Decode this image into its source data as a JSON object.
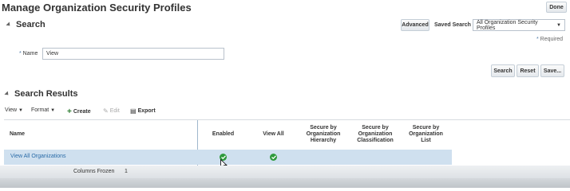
{
  "page": {
    "title": "Manage Organization Security Profiles"
  },
  "header": {
    "done_label": "Done"
  },
  "search": {
    "heading": "Search",
    "advanced_label": "Advanced",
    "saved_search_label": "Saved Search",
    "saved_search_value": "All Organization Security Profiles",
    "required_note": "Required",
    "name_label": "Name",
    "name_value": "View",
    "search_label": "Search",
    "reset_label": "Reset",
    "save_label": "Save..."
  },
  "results": {
    "heading": "Search Results",
    "toolbar": {
      "view": "View",
      "format": "Format",
      "create": "Create",
      "edit": "Edit",
      "export": "Export"
    },
    "columns": [
      "Name",
      "Enabled",
      "View All",
      "Secure by Organization Hierarchy",
      "Secure by Organization Classification",
      "Secure by Organization List"
    ],
    "rows": [
      {
        "name": "View All Organizations",
        "enabled": true,
        "view_all": true
      }
    ],
    "footer": {
      "frozen_label": "Columns Frozen",
      "frozen_count": "1"
    }
  }
}
